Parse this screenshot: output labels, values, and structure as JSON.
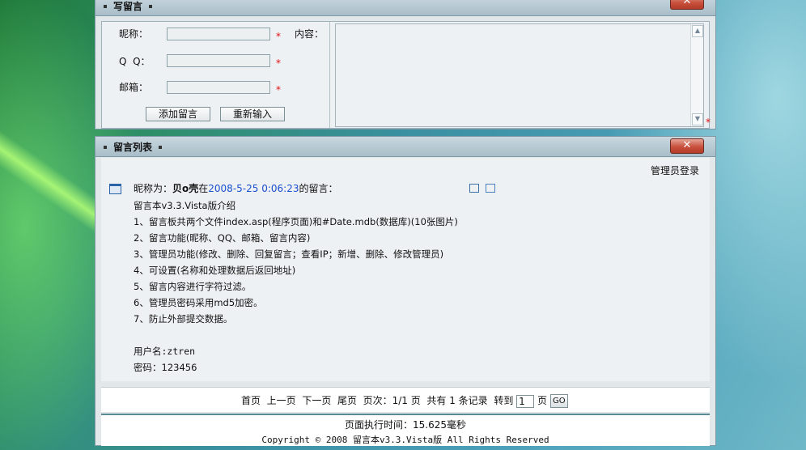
{
  "write_panel": {
    "title": "写留言",
    "close": "✕",
    "nickname_label": "昵称：",
    "qq_label": "Q  Q：",
    "email_label": "邮箱：",
    "content_label": "内容：",
    "required_mark": "*",
    "nickname_value": "",
    "qq_value": "",
    "email_value": "",
    "submit_label": "添加留言",
    "reset_label": "重新输入"
  },
  "list_panel": {
    "title": "留言列表",
    "close": "✕",
    "admin_login": "管理员登录",
    "entry": {
      "prefix": "昵称为：",
      "nickname": "贝o壳",
      "at": "在",
      "datetime": "2008-5-25 0:06:23",
      "suffix": "的留言：",
      "lines": [
        "留言本v3.3.Vista版介绍",
        "1、留言板共两个文件index.asp(程序页面)和#Date.mdb(数据库)(10张图片)",
        "2、留言功能(昵称、QQ、邮箱、留言内容)",
        "3、管理员功能(修改、删除、回复留言；查看IP；新增、删除、修改管理员)",
        "4、可设置(名称和处理数据后返回地址)",
        "5、留言内容进行字符过滤。",
        "6、管理员密码采用md5加密。",
        "7、防止外部提交数据。",
        "",
        "用户名:ztren",
        "密码：123456"
      ]
    },
    "pager": {
      "first": "首页",
      "prev": "上一页",
      "next": "下一页",
      "last": "尾页",
      "page_info": "页次：1/1 页",
      "total": "共有 1 条记录",
      "goto": "转到",
      "page_value": "1",
      "page_unit": "页",
      "go_button": "GO"
    },
    "footer": {
      "exec_time": "页面执行时间：15.625毫秒",
      "copyright": "Copyright © 2008 留言本v3.3.Vista版 All Rights Reserved"
    }
  }
}
